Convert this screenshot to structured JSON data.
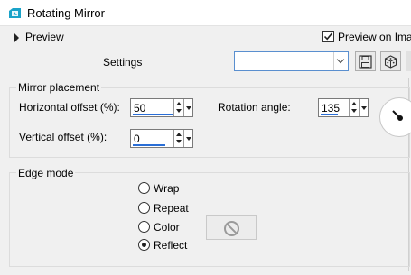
{
  "window": {
    "title": "Rotating Mirror",
    "icon": "app-icon"
  },
  "preview_bar": {
    "toggle_label": "Preview",
    "checkbox_label": "Preview on Image",
    "checkbox_checked": true
  },
  "settings_bar": {
    "label": "Settings",
    "combo_value": "",
    "save_icon": "save-icon",
    "randomize_icon": "dice-icon"
  },
  "mirror_placement": {
    "legend": "Mirror placement",
    "horizontal_offset_label": "Horizontal offset (%):",
    "horizontal_offset_value": "50",
    "vertical_offset_label": "Vertical offset (%):",
    "vertical_offset_value": "0",
    "rotation_angle_label": "Rotation angle:",
    "rotation_angle_value": "135"
  },
  "edge_mode": {
    "legend": "Edge mode",
    "options": [
      {
        "label": "Wrap",
        "selected": false
      },
      {
        "label": "Repeat",
        "selected": false
      },
      {
        "label": "Color",
        "selected": false
      },
      {
        "label": "Reflect",
        "selected": true
      }
    ],
    "color_swatch_icon": "disabled-icon"
  },
  "colors": {
    "accent": "#2a6ed6",
    "app_icon": "#1aa3c9"
  }
}
